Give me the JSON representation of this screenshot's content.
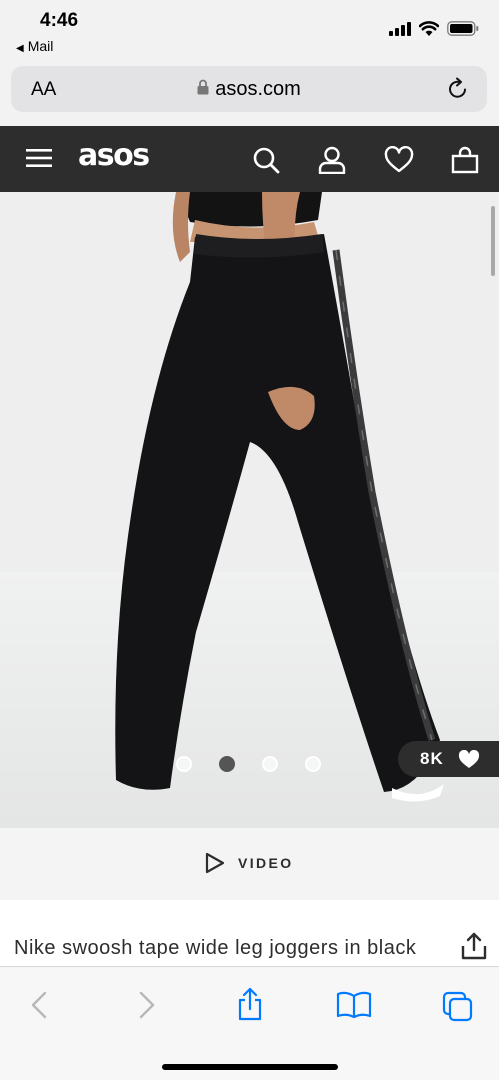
{
  "status_bar": {
    "time": "4:46",
    "back_app": "Mail",
    "icons": [
      "cellular-signal-icon",
      "wifi-icon",
      "battery-icon"
    ]
  },
  "browser": {
    "text_size_label": "AA",
    "url": "asos.com",
    "icons": [
      "lock-icon",
      "reload-icon"
    ]
  },
  "site_header": {
    "logo": "asos",
    "icons": [
      "menu-icon",
      "search-icon",
      "account-icon",
      "wishlist-icon",
      "bag-icon"
    ]
  },
  "gallery": {
    "image_count": 4,
    "active_index": 1,
    "save_count": "8K"
  },
  "video": {
    "label": "VIDEO"
  },
  "product": {
    "title": "Nike swoosh tape wide leg joggers in black"
  },
  "toolbar": {
    "icons": [
      "back-icon",
      "forward-icon",
      "share-icon",
      "bookmarks-icon",
      "tabs-icon"
    ]
  },
  "colors": {
    "header": "#2d2d2d",
    "accent": "#007aff",
    "image_bg": "#eceded"
  }
}
